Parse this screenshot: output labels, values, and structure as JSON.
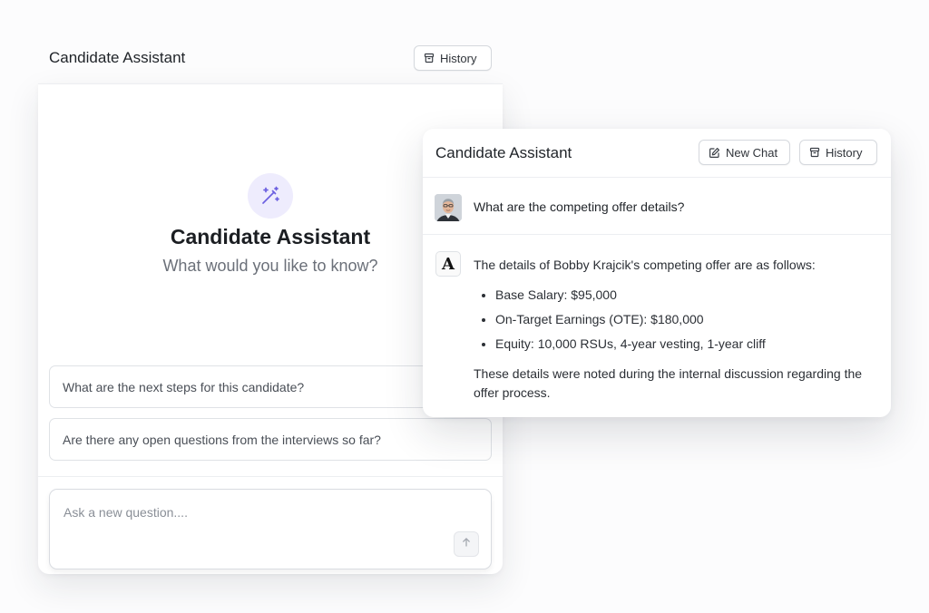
{
  "left_panel": {
    "title": "Candidate Assistant",
    "history_label": "History",
    "hero_title": "Candidate Assistant",
    "hero_subtitle": "What would you like to know?",
    "suggestions": [
      "What are the next steps for this candidate?",
      "Are there any open questions from the interviews so far?"
    ],
    "ask_placeholder": "Ask a new question...."
  },
  "right_panel": {
    "title": "Candidate Assistant",
    "new_chat_label": "New Chat",
    "history_label": "History",
    "user_question": "What are the competing offer details?",
    "answer_intro": "The details of Bobby Krajcik's competing offer are as follows:",
    "answer_items": [
      "Base Salary: $95,000",
      "On-Target Earnings (OTE): $180,000",
      "Equity: 10,000 RSUs, 4-year vesting, 1-year cliff"
    ],
    "answer_outro": "These details were noted during the internal discussion regarding the offer process.",
    "assistant_logo_letter": "A"
  },
  "icons": {
    "history": "archive-icon",
    "new_chat": "edit-square-icon",
    "hero": "magic-wand-icon",
    "send": "arrow-up-icon"
  },
  "colors": {
    "accent": "#6b5fe0",
    "accent_bg": "#eeecfd",
    "text_primary": "#1f2328",
    "text_muted": "#6b7079",
    "border": "#dfe2e6"
  }
}
